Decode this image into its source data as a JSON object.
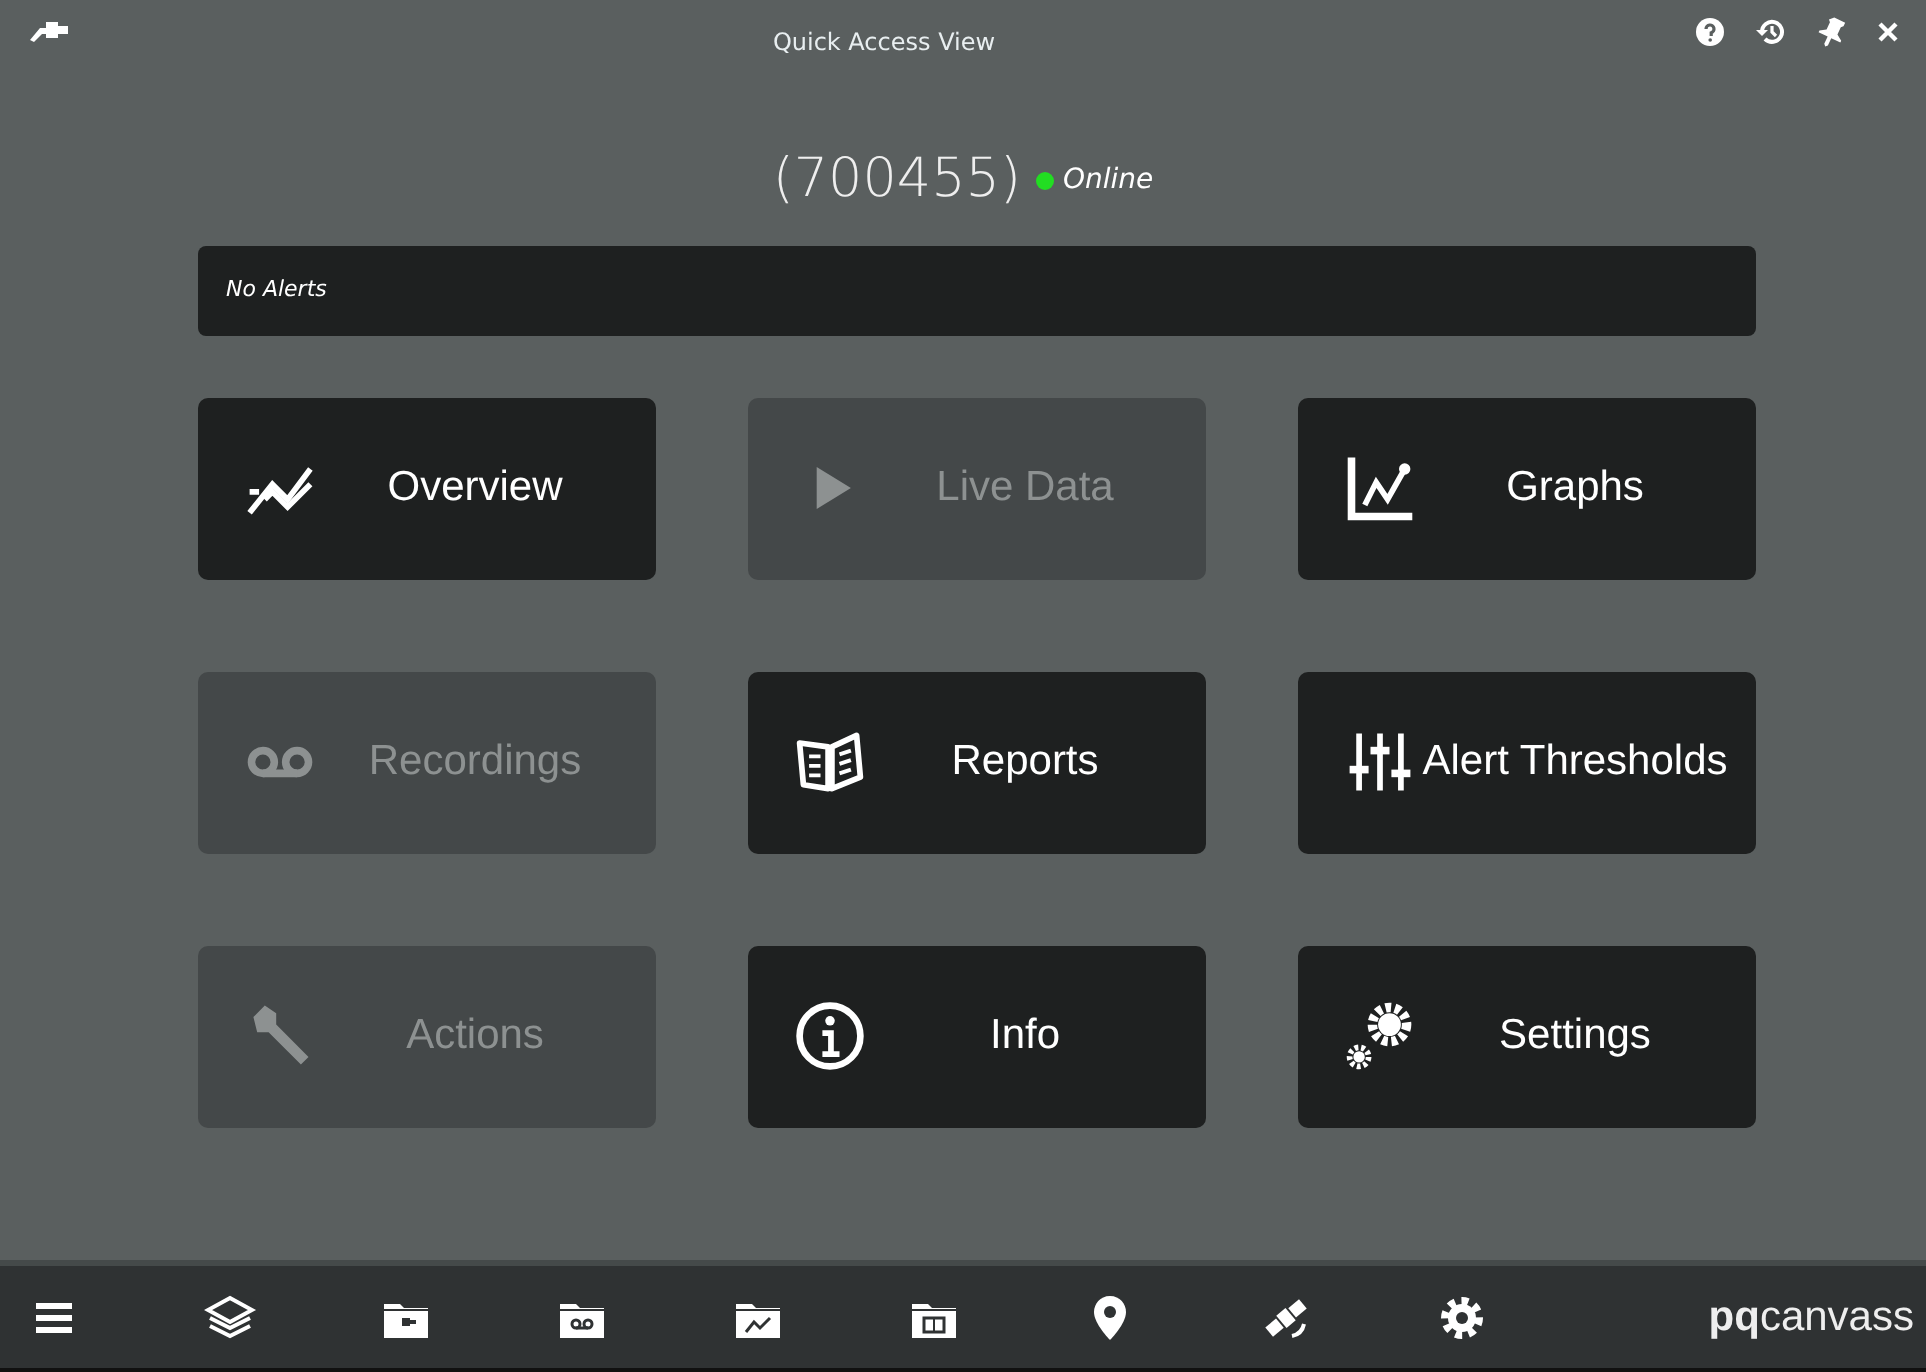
{
  "window": {
    "title": "Quick Access View"
  },
  "device": {
    "id": "(700455)",
    "status": "Online",
    "online": true
  },
  "alerts": {
    "text": "No Alerts"
  },
  "tiles": [
    {
      "kind": "overview",
      "label": "Overview",
      "disabled": false
    },
    {
      "kind": "live",
      "label": "Live Data",
      "disabled": true
    },
    {
      "kind": "graphs",
      "label": "Graphs",
      "disabled": false
    },
    {
      "kind": "recordings",
      "label": "Recordings",
      "disabled": true
    },
    {
      "kind": "reports",
      "label": "Reports",
      "disabled": false
    },
    {
      "kind": "thresholds",
      "label": "Alert Thresholds",
      "disabled": false
    },
    {
      "kind": "actions",
      "label": "Actions",
      "disabled": true
    },
    {
      "kind": "info",
      "label": "Info",
      "disabled": false
    },
    {
      "kind": "settings",
      "label": "Settings",
      "disabled": false
    }
  ],
  "toolbar": [
    {
      "kind": "menu"
    },
    {
      "kind": "layers"
    },
    {
      "kind": "folder-plug"
    },
    {
      "kind": "folder-tape"
    },
    {
      "kind": "folder-chart"
    },
    {
      "kind": "folder-book"
    },
    {
      "kind": "pin"
    },
    {
      "kind": "satellite"
    },
    {
      "kind": "gear"
    }
  ],
  "brand": "**pq**canvass"
}
